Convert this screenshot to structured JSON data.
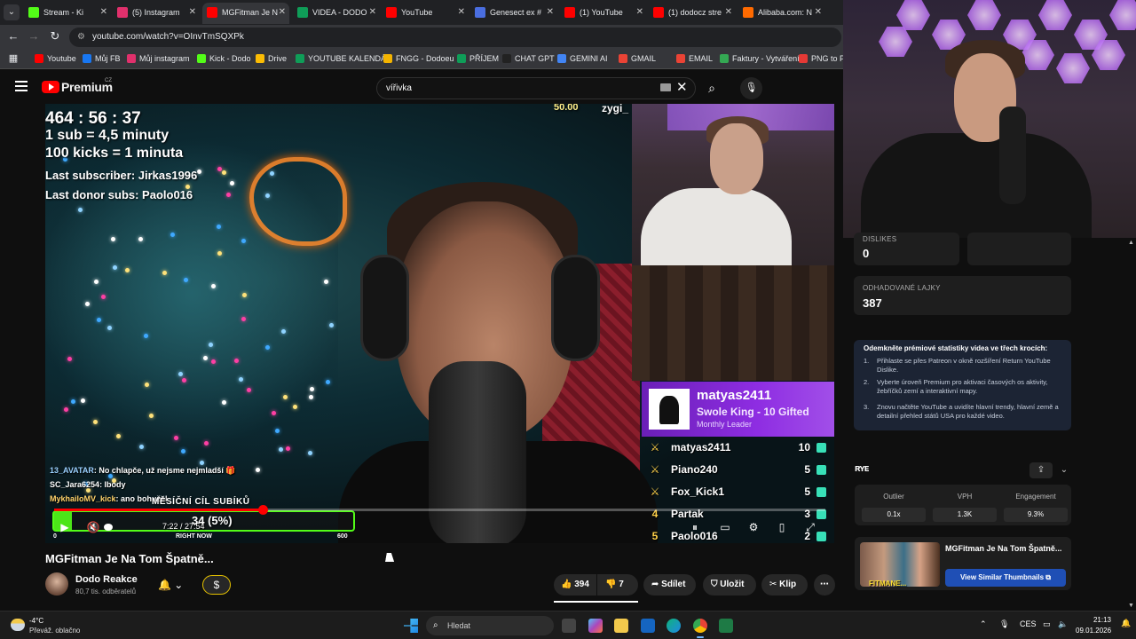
{
  "browser": {
    "tabs": [
      {
        "label": "Stream - Ki",
        "color": "#53fc18",
        "active": false
      },
      {
        "label": "(5) Instagram",
        "color": "#e1306c",
        "active": false
      },
      {
        "label": "MGFitman Je N",
        "color": "#ff0000",
        "active": true
      },
      {
        "label": "VIDEA - DODO",
        "color": "#0f9d58",
        "active": false
      },
      {
        "label": "YouTube",
        "color": "#ff0000",
        "active": false
      },
      {
        "label": "Genesect ex #",
        "color": "#4a6ee0",
        "active": false
      },
      {
        "label": "(1) YouTube",
        "color": "#ff0000",
        "active": false
      },
      {
        "label": "(1) dodocz stre",
        "color": "#ff0000",
        "active": false
      },
      {
        "label": "Alibaba.com: N",
        "color": "#ff6a00",
        "active": false
      }
    ],
    "url": "youtube.com/watch?v=OInvTmSQXPk",
    "bookmarks": [
      {
        "label": "Youtube",
        "color": "#ff0000"
      },
      {
        "label": "Můj FB",
        "color": "#1877f2"
      },
      {
        "label": "Můj instagram",
        "color": "#e1306c"
      },
      {
        "label": "Kick - Dodo",
        "color": "#53fc18"
      },
      {
        "label": "Drive",
        "color": "#fbbc04"
      },
      {
        "label": "YOUTUBE KALENDÁŘ",
        "color": "#0f9d58"
      },
      {
        "label": "FNGG - Dodoeu",
        "color": "#f4b400"
      },
      {
        "label": "PŘÍJEM",
        "color": "#0f9d58"
      },
      {
        "label": "CHAT GPT",
        "color": "#222222"
      },
      {
        "label": "GEMINI AI",
        "color": "#4285f4"
      },
      {
        "label": "GMAIL",
        "color": "#ea4335"
      },
      {
        "label": "EMAIL",
        "color": "#ea4335"
      },
      {
        "label": "Faktury - Vytváření",
        "color": "#34a853"
      },
      {
        "label": "PNG to PD",
        "color": "#e53935"
      }
    ]
  },
  "youtube": {
    "brand": "Premium",
    "country": "CZ",
    "search_value": "vířivka"
  },
  "player": {
    "overlay": {
      "timer": "464 : 56 : 37",
      "rule1": "1 sub = 4,5 minuty",
      "rule2": "100 kicks = 1 minuta",
      "last_sub": "Last subscriber: Jirkas1996",
      "last_donor": "Last donor subs: Paolo016",
      "corner_amount": "50.00",
      "corner_name": "zygi_"
    },
    "leader": {
      "name": "matyas2411",
      "title": "Swole King - 10 Gifted",
      "subtitle": "Monthly Leader"
    },
    "leaderboard": [
      {
        "rank": "",
        "name": "matyas2411",
        "count": "10"
      },
      {
        "rank": "",
        "name": "Piano240",
        "count": "5"
      },
      {
        "rank": "",
        "name": "Fox_Kick1",
        "count": "5"
      },
      {
        "rank": "4",
        "name": "Partak",
        "count": "3"
      },
      {
        "rank": "5",
        "name": "Paolo016",
        "count": "2"
      }
    ],
    "chat": [
      {
        "user": "13_AVATAR",
        "text": ": No chlapče, už nejsme nejmladší 🎁",
        "color": "#9ad0ff"
      },
      {
        "user": "SC_Jara6254",
        "text": ": Ibody",
        "color": "#ffffff"
      },
      {
        "user": "MykhailoMV_kick",
        "text": ": ano bohužel",
        "color": "#ffd36b"
      }
    ],
    "goal": {
      "title": "MĚSÍČNÍ CÍL SUBÍKŮ",
      "value": "34 (5%)",
      "fraction": 0.06,
      "min": "0",
      "now": "RIGHT NOW",
      "max": "600"
    },
    "time": "7:22 / 27:54",
    "progress": 0.27
  },
  "video": {
    "title": "MGFitman Je Na Tom Špatně...",
    "channel": "Dodo Reakce",
    "subscribers": "80,7 tis. odběratelů",
    "likes": "394",
    "dislikes": "7",
    "share": "Sdílet",
    "save": "Uložit",
    "clip": "Klip"
  },
  "stats": {
    "dislikes_label": "DISLIKES",
    "dislikes_value": "0",
    "est_likes_label": "ODHADOVANÉ LAJKY",
    "est_likes_value": "387",
    "premium_title": "Odemkněte prémiové statistiky videa ve třech krocích:",
    "steps": [
      {
        "num": "1.",
        "text": "Přihlaste se přes Patreon v okně rozšíření Return YouTube Dislike."
      },
      {
        "num": "2.",
        "text": "Vyberte úroveň Premium pro aktivaci časových os aktivity, žebříčků zemí a interaktivní mapy."
      },
      {
        "num": "3.",
        "text": "Znovu načtěte YouTube a uvidíte hlavní trendy, hlavní země a detailní přehled států USA pro každé video."
      }
    ]
  },
  "extension": {
    "logo": "ʀʏᴇ",
    "metrics": [
      {
        "label": "Outlier",
        "value": "0.1x"
      },
      {
        "label": "VPH",
        "value": "1.3K"
      },
      {
        "label": "Engagement",
        "value": "9.3%"
      }
    ],
    "thumb_title": "MGFitman Je Na Tom Špatně...",
    "thumb_caption": "FITMANE...",
    "thumb_button": "View Similar Thumbnails ⧉"
  },
  "taskbar": {
    "temp": "-4°C",
    "weather": "Převáž. oblačno",
    "search_placeholder": "Hledat",
    "lang": "CES",
    "time": "21:13",
    "date": "09.01.2026"
  }
}
